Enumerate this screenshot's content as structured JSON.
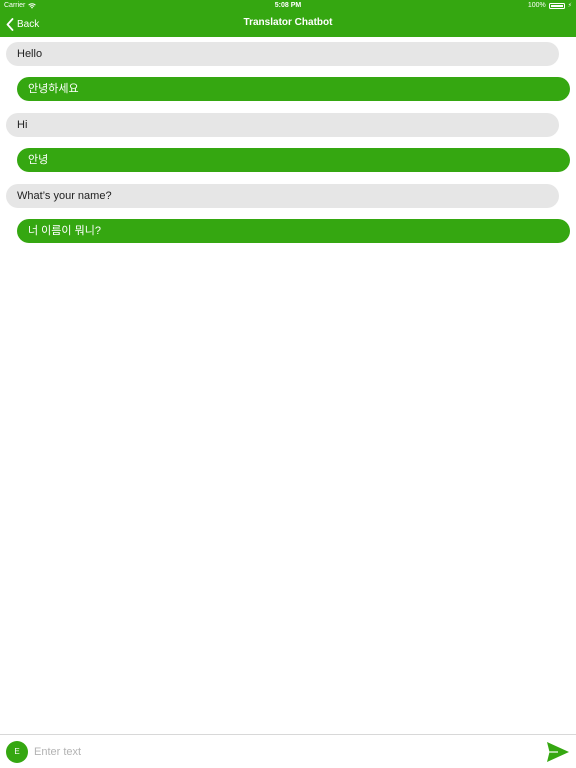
{
  "status_bar": {
    "carrier": "Carrier",
    "time": "5:08 PM",
    "battery": "100%"
  },
  "nav": {
    "back_label": "Back",
    "title": "Translator Chatbot"
  },
  "messages": [
    {
      "role": "user",
      "text": "Hello"
    },
    {
      "role": "bot",
      "text": "안녕하세요"
    },
    {
      "role": "user",
      "text": "Hi"
    },
    {
      "role": "bot",
      "text": "안녕"
    },
    {
      "role": "user",
      "text": "What’s your name?"
    },
    {
      "role": "bot",
      "text": "너 이름이 뭐니?"
    }
  ],
  "composer": {
    "avatar_initial": "E",
    "placeholder": "Enter text",
    "value": ""
  },
  "colors": {
    "accent": "#35a711",
    "user_bubble": "#e6e6e6"
  },
  "icons": {
    "back": "chevron-left-icon",
    "send": "send-icon",
    "wifi": "wifi-icon",
    "battery": "battery-icon"
  }
}
